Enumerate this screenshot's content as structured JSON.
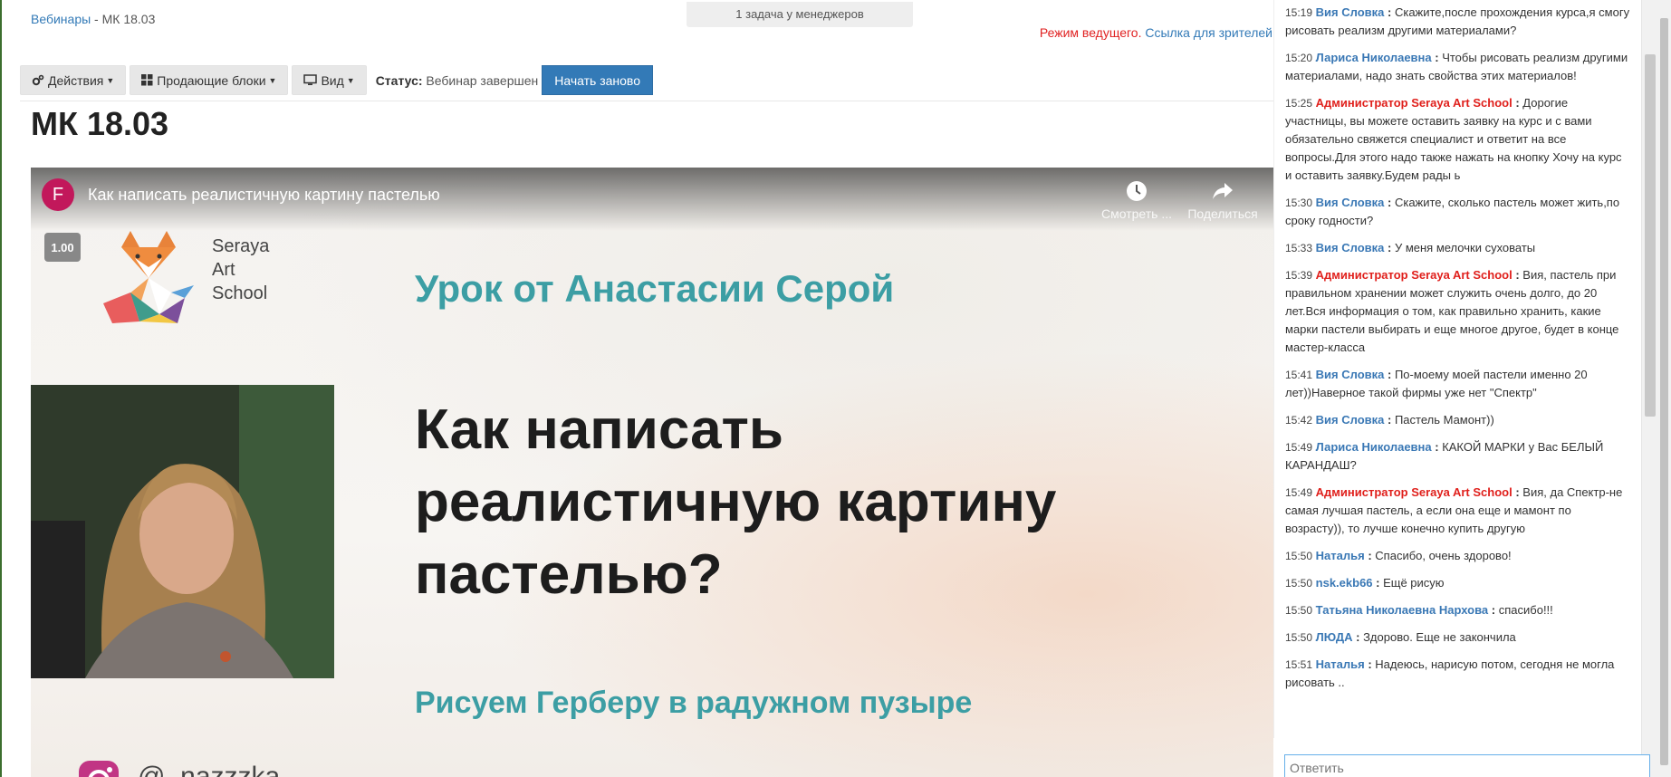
{
  "breadcrumb": {
    "root": "Вебинары",
    "sep": " - ",
    "current": "МК 18.03"
  },
  "notification": "1 задача у менеджеров",
  "host_links": {
    "mode": "Режим ведущего",
    "dot": ". ",
    "viewers": "Ссылка для зрителей"
  },
  "toolbar": {
    "actions": "Действия",
    "blocks": "Продающие блоки",
    "view": "Вид",
    "status_label": "Статус:",
    "status_value": "Вебинар завершен",
    "restart": "Начать заново"
  },
  "page_title": "МК 18.03",
  "video": {
    "channel_initial": "F",
    "title": "Как написать реалистичную картину пастелью",
    "watch_later": "Смотреть ...",
    "share": "Поделиться",
    "speed": "1.00",
    "school_name": [
      "Seraya",
      "Art",
      "School"
    ],
    "lesson_from": "Урок от Анастасии Серой",
    "big_title": [
      "Как написать",
      "реалистичную картину",
      "пастелью?"
    ],
    "subtitle": "Рисуем Герберу в радужном пузыре",
    "insta_handle": "@_nazzzka"
  },
  "chat": {
    "messages": [
      {
        "time": "15:19",
        "author": "Вия Словка",
        "admin": false,
        "text": "Скажите,после прохождения курса,я смогу рисовать реализм другими материалами?"
      },
      {
        "time": "15:20",
        "author": "Лариса Николаевна",
        "admin": false,
        "text": "Чтобы рисовать реализм другими материалами, надо знать свойства этих материалов!"
      },
      {
        "time": "15:25",
        "author": "Администратор Seraya Art School",
        "admin": true,
        "text": "Дорогие участницы, вы можете оставить заявку на курс и с вами обязательно свяжется специалист и ответит на все вопросы.Для этого надо также нажать на кнопку Хочу на курс и оставить заявку.Будем рады ь"
      },
      {
        "time": "15:30",
        "author": "Вия Словка",
        "admin": false,
        "text": "Скажите, сколько пастель может жить,по сроку годности?"
      },
      {
        "time": "15:33",
        "author": "Вия Словка",
        "admin": false,
        "text": "У меня мелочки суховаты"
      },
      {
        "time": "15:39",
        "author": "Администратор Seraya Art School",
        "admin": true,
        "text": "Вия, пастель при правильном хранении может служить очень долго, до 20 лет.Вся информация о том, как правильно хранить, какие марки пастели выбирать и еще многое другое, будет в конце мастер-класса"
      },
      {
        "time": "15:41",
        "author": "Вия Словка",
        "admin": false,
        "text": "По-моему моей пастели именно 20 лет))Наверное такой фирмы уже нет \"Спектр\""
      },
      {
        "time": "15:42",
        "author": "Вия Словка",
        "admin": false,
        "text": "Пастель Мамонт))"
      },
      {
        "time": "15:49",
        "author": "Лариса Николаевна",
        "admin": false,
        "text": "КАКОЙ МАРКИ у Вас БЕЛЫЙ КАРАНДАШ?"
      },
      {
        "time": "15:49",
        "author": "Администратор Seraya Art School",
        "admin": true,
        "text": "Вия, да Спектр-не самая лучшая пастель, а если она еще и мамонт по возрасту)), то лучше конечно купить другую"
      },
      {
        "time": "15:50",
        "author": "Наталья",
        "admin": false,
        "text": "Спасибо, очень здорово!"
      },
      {
        "time": "15:50",
        "author": "nsk.ekb66",
        "admin": false,
        "text": "Ещё рисую"
      },
      {
        "time": "15:50",
        "author": "Татьяна Николаевна Нархова",
        "admin": false,
        "text": "спасибо!!!"
      },
      {
        "time": "15:50",
        "author": "ЛЮДА",
        "admin": false,
        "text": "Здорово. Еще не закончила"
      },
      {
        "time": "15:51",
        "author": "Наталья",
        "admin": false,
        "text": "Надеюсь, нарисую потом, сегодня не могла рисовать .."
      }
    ],
    "reply_placeholder": "Ответить"
  },
  "colors": {
    "accent": "#337ab7",
    "admin": "#e0201c",
    "teal": "#3c9ea4"
  }
}
